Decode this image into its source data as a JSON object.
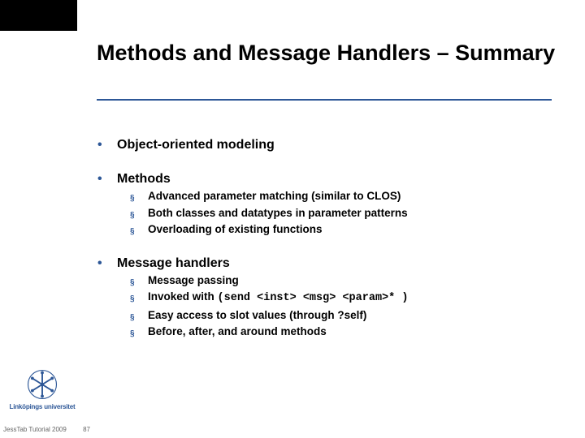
{
  "title": "Methods and Message Handlers – Summary",
  "bullets": {
    "b0": "Object-oriented modeling",
    "b1": "Methods",
    "b1_0": "Advanced parameter matching (similar to CLOS)",
    "b1_1": "Both classes and datatypes in parameter patterns",
    "b1_2": "Overloading of existing functions",
    "b2": "Message handlers",
    "b2_0": "Message passing",
    "b2_1_pre": "Invoked with ",
    "b2_1_code": "(send <inst> <msg> <param>* )",
    "b2_2": "Easy access to slot values (through ?self)",
    "b2_3": "Before, after, and around methods"
  },
  "logo_text": "Linköpings universitet",
  "footer_text": "JessTab Tutorial 2009",
  "page_number": "87",
  "colors": {
    "accent": "#2d5797"
  }
}
